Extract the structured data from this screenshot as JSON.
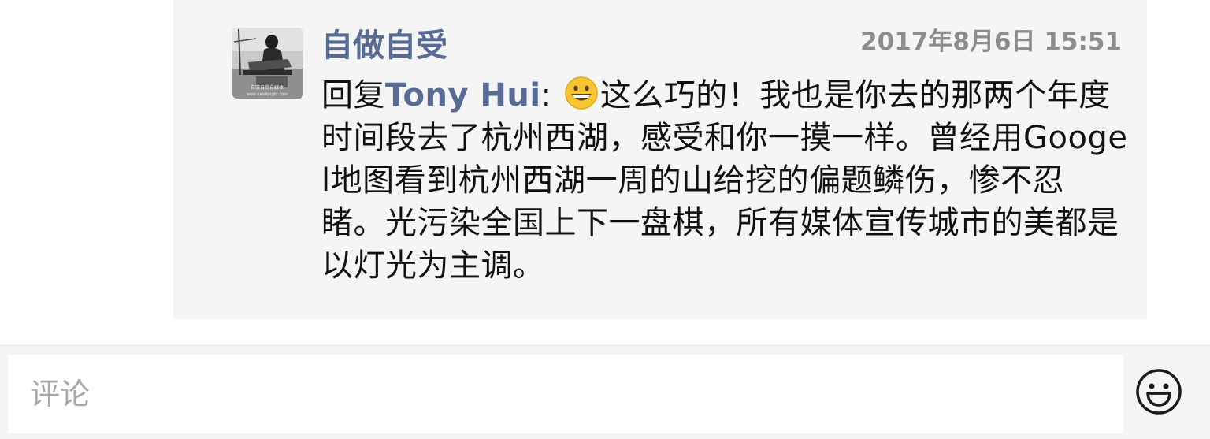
{
  "comment": {
    "author": "自做自受",
    "timestamp": "2017年8月6日 15:51",
    "reply_prefix": "回复",
    "reply_target": "Tony Hui",
    "reply_colon": ":",
    "emoji_icon": "grinning-face-emoji",
    "text": "这么巧的！我也是你去的那两个年度时间段去了杭州西湖，感受和你一摸一样。曾经用Googel地图看到杭州西湖一周的山给挖的偏题鳞伤，惨不忍睹。光污染全国上下一盘棋，所有媒体宣传城市的美都是以灯光为主调。",
    "avatar": {
      "icon": "user-avatar-photo",
      "watermark_line1": "自做自受自媒体",
      "watermark_line2": "www.easybright.com"
    }
  },
  "input": {
    "placeholder": "评论",
    "emoji_button_icon": "smiley-face-icon"
  },
  "colors": {
    "link": "#576b95",
    "panel_background": "#f5f5f5",
    "timestamp": "#8c8c8c",
    "text": "#111111"
  }
}
